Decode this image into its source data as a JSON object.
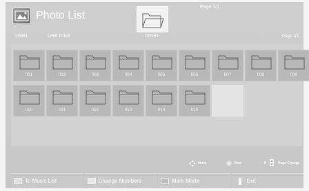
{
  "header": {
    "title": "Photo List",
    "page_indicator": "Page 1/1",
    "path": {
      "device": "USB1",
      "drive_name": "USB Drive",
      "folder": "Drive1"
    },
    "page_right": "Page 1/1"
  },
  "grid": {
    "folders": [
      "001",
      "002",
      "003",
      "004",
      "005",
      "006",
      "007",
      "008",
      "009",
      "010",
      "011",
      "012",
      "013",
      "014",
      "015"
    ]
  },
  "legend": {
    "move": "Move",
    "view": "View",
    "p_label": "P",
    "page_change": "Page Change"
  },
  "buttons": [
    {
      "label": "To Music List",
      "color": "#e0e0e0"
    },
    {
      "label": "Change Numbers",
      "color": "#e8e8e8"
    },
    {
      "label": "Mark Mode",
      "color": "#bdbdbd"
    },
    {
      "label": "Exit",
      "color": "#f0f0f0"
    }
  ],
  "icons": {
    "app": "photo-icon",
    "folder": "folder-icon",
    "move": "dpad-icon",
    "view": "enter-icon",
    "exit": "exit-icon"
  }
}
